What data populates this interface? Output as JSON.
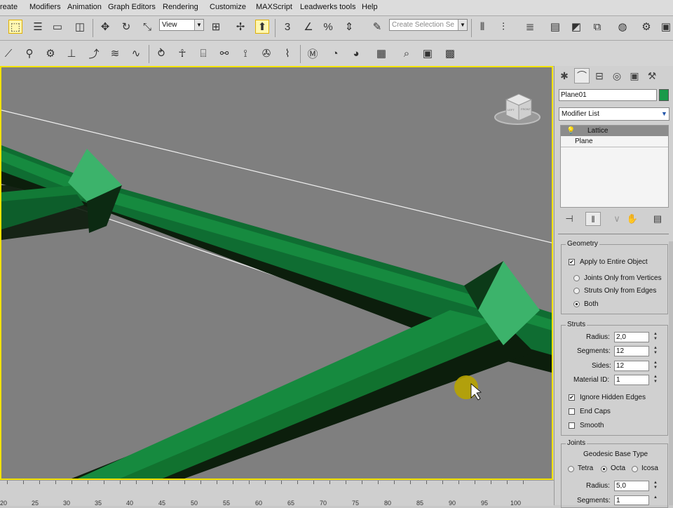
{
  "menu": [
    "reate",
    "Modifiers",
    "Animation",
    "Graph Editors",
    "Rendering",
    "Customize",
    "MAXScript",
    "Leadwerks tools",
    "Help"
  ],
  "toolbar": {
    "view_dropdown": "View",
    "create_selection_set": "Create Selection Se",
    "snap_label": "3",
    "percent_label": "%"
  },
  "command_panel": {
    "tabs": [
      "create-tab",
      "modify-tab",
      "hierarchy-tab",
      "motion-tab",
      "display-tab",
      "utilities-tab"
    ],
    "object_name": "Plane01",
    "object_color": "#1a9a4a",
    "modifier_list": "Modifier List",
    "stack": [
      "Lattice",
      "Plane"
    ]
  },
  "geometry": {
    "title": "Geometry",
    "apply_entire": "Apply to Entire Object",
    "opt_joints": "Joints Only from Vertices",
    "opt_struts": "Struts Only from Edges",
    "opt_both": "Both"
  },
  "struts": {
    "title": "Struts",
    "radius_label": "Radius:",
    "radius": "2,0",
    "segments_label": "Segments:",
    "segments": "12",
    "sides_label": "Sides:",
    "sides": "12",
    "matid_label": "Material ID:",
    "matid": "1",
    "ignore_hidden": "Ignore Hidden Edges",
    "end_caps": "End Caps",
    "smooth": "Smooth"
  },
  "joints": {
    "title": "Joints",
    "geodesic": "Geodesic Base Type",
    "tetra": "Tetra",
    "octa": "Octa",
    "icosa": "Icosa",
    "radius_label": "Radius:",
    "radius": "5,0",
    "segments_label": "Segments:",
    "segments": "1"
  },
  "ruler_labels": [
    "20",
    "25",
    "30",
    "35",
    "40",
    "45",
    "50",
    "55",
    "60",
    "65",
    "70",
    "75",
    "80",
    "85",
    "90",
    "95",
    "100"
  ],
  "viewcube_faces": [
    "LEFT",
    "FRONT"
  ]
}
